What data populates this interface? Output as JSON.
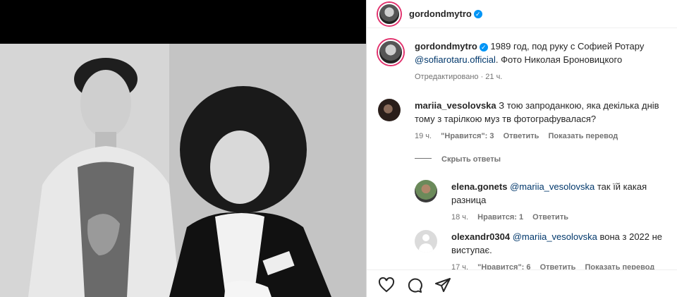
{
  "post": {
    "author": "gordondmytro",
    "caption": "1989 год, под руку с Софией Ротару",
    "caption_mention": "@sofiarotaru.official",
    "caption_tail": ". Фото Николая Броновицкого",
    "edited": "Отредактировано · 21 ч."
  },
  "comments": [
    {
      "user": "mariia_vesolovska",
      "text": "З тою запроданкою, яка декілька днів тому з тарілкою муз тв фотографувалася?",
      "time": "19 ч.",
      "likes": "\"Нравится\": 3",
      "reply": "Ответить",
      "translate": "Показать перевод"
    }
  ],
  "hide_replies": "Скрыть ответы",
  "replies": [
    {
      "user": "elena.gonets",
      "mention": "@mariia_vesolovska",
      "text": "так їй какая разница",
      "time": "18 ч.",
      "likes": "Нравится: 1",
      "reply": "Ответить"
    },
    {
      "user": "olexandr0304",
      "mention": "@mariia_vesolovska",
      "text": "вона з 2022 не виступає.",
      "time": "17 ч.",
      "likes": "\"Нравится\": 6",
      "reply": "Ответить",
      "translate": "Показать перевод"
    }
  ],
  "icons": {
    "like": "heart-icon",
    "comment": "comment-icon",
    "share": "share-icon"
  }
}
